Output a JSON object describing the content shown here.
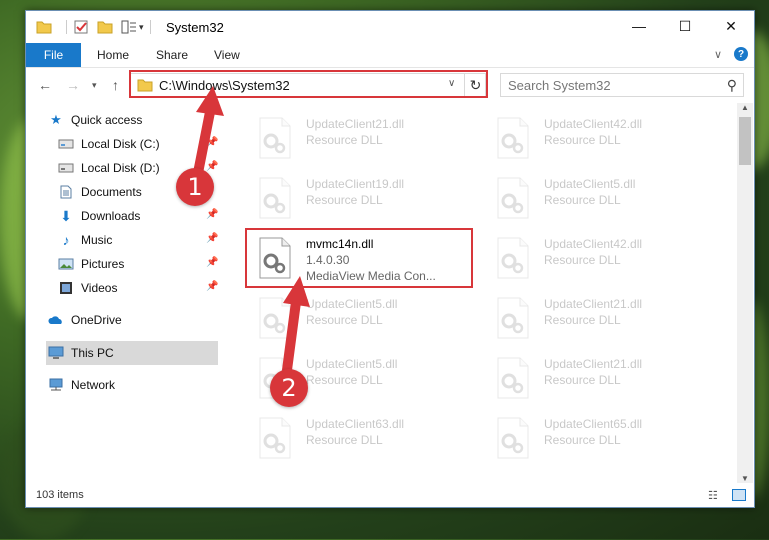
{
  "window": {
    "title": "System32",
    "controls": {
      "minimize": "—",
      "maximize": "☐",
      "close": "✕"
    }
  },
  "ribbon": {
    "file": "File",
    "tabs": [
      "Home",
      "Share",
      "View"
    ]
  },
  "nav": {
    "address": "C:\\Windows\\System32",
    "search_placeholder": "Search System32"
  },
  "sidebar": {
    "quick_access": "Quick access",
    "items": [
      {
        "label": "Local Disk (C:)",
        "icon": "drive-icon"
      },
      {
        "label": "Local Disk (D:)",
        "icon": "drive-icon"
      },
      {
        "label": "Documents",
        "icon": "documents-icon"
      },
      {
        "label": "Downloads",
        "icon": "downloads-icon"
      },
      {
        "label": "Music",
        "icon": "music-icon"
      },
      {
        "label": "Pictures",
        "icon": "pictures-icon"
      },
      {
        "label": "Videos",
        "icon": "videos-icon"
      }
    ],
    "onedrive": "OneDrive",
    "this_pc": "This PC",
    "network": "Network"
  },
  "files": [
    {
      "name": "UpdateClient21.dll",
      "desc": "Resource DLL",
      "faded": true
    },
    {
      "name": "UpdateClient42.dll",
      "desc": "Resource DLL",
      "faded": true
    },
    {
      "name": "UpdateClient19.dll",
      "desc": "Resource DLL",
      "faded": true
    },
    {
      "name": "UpdateClient5.dll",
      "desc": "Resource DLL",
      "faded": true
    },
    {
      "name": "mvmc14n.dll",
      "desc": "1.4.0.30",
      "desc2": "MediaView Media Con...",
      "faded": false
    },
    {
      "name": "UpdateClient42.dll",
      "desc": "Resource DLL",
      "faded": true
    },
    {
      "name": "UpdateClient5.dll",
      "desc": "Resource DLL",
      "faded": true
    },
    {
      "name": "UpdateClient21.dll",
      "desc": "Resource DLL",
      "faded": true
    },
    {
      "name": "UpdateClient5.dll",
      "desc": "Resource DLL",
      "faded": true
    },
    {
      "name": "UpdateClient21.dll",
      "desc": "Resource DLL",
      "faded": true
    },
    {
      "name": "UpdateClient63.dll",
      "desc": "Resource DLL",
      "faded": true
    },
    {
      "name": "UpdateClient65.dll",
      "desc": "Resource DLL",
      "faded": true
    }
  ],
  "status": {
    "count": "103 items"
  },
  "callouts": {
    "one": "1",
    "two": "2"
  },
  "colors": {
    "accent": "#1979ca",
    "highlight": "#d8363a",
    "folder": "#f2c94c"
  }
}
